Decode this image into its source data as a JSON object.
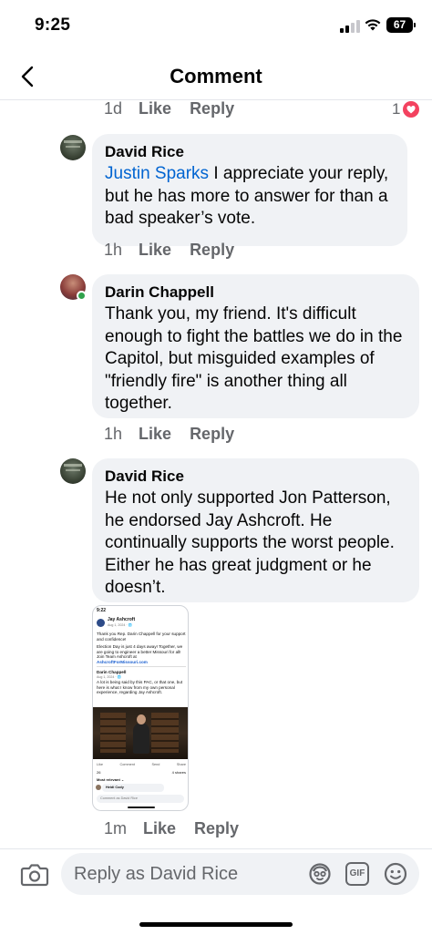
{
  "status_bar": {
    "time": "9:25",
    "battery": "67"
  },
  "header": {
    "title": "Comment"
  },
  "comments": [
    {
      "id": "prev",
      "meta": {
        "time": "1d",
        "like": "Like",
        "reply": "Reply"
      },
      "reactions": {
        "count": "1",
        "type": "heart-icon",
        "color": "#f3425f"
      }
    },
    {
      "id": "c1",
      "author": "David Rice",
      "mention": "Justin Sparks",
      "text": " I appreciate your reply, but he has more to answer for than a bad speaker’s vote.",
      "meta": {
        "time": "1h",
        "like": "Like",
        "reply": "Reply"
      }
    },
    {
      "id": "c2",
      "author": "Darin Chappell",
      "online": true,
      "text": "Thank you, my friend. It's difficult enough to fight the battles we do in the Capitol, but misguided examples of \"friendly fire\" is another thing all together.",
      "meta": {
        "time": "1h",
        "like": "Like",
        "reply": "Reply"
      }
    },
    {
      "id": "c3",
      "author": "David Rice",
      "text": "He not only supported Jon Patterson, he endorsed Jay Ashcroft. He continually supports the worst people. Either he has great judgment or he doesn’t.",
      "meta": {
        "time": "1m",
        "like": "Like",
        "reply": "Reply"
      },
      "attachment": {
        "status_time": "9:22",
        "page_name": "Jay Ashcroft",
        "post_date": "Aug 1, 2024 · 🌐",
        "line1": "Thank you Rep. Darin Chappell for your support and confidence!",
        "line2": "Election Day is just 4 days away! Together, we are going to engineer a better Missouri for all! Join Team Ashcroft at",
        "link": "AshcroftForMissouri.com",
        "inner_name": "Darin Chappell",
        "inner_date": "Aug 1, 2024 · 🌐",
        "inner_text": "A lot is being said by this PAC, or that one, but here is what I know from my own personal experience, regarding Jay Ashcroft.",
        "action_like": "Like",
        "action_comment": "Comment",
        "action_send": "Send",
        "action_share": "Share",
        "reactions": "26",
        "shares": "4 shares",
        "most_relevant": "Most relevant ⌄",
        "commenter": "Heidi Cody",
        "input_placeholder": "Comment as David Rice"
      }
    }
  ],
  "composer": {
    "placeholder": "Reply as David Rice",
    "gif_label": "GIF"
  },
  "colors": {
    "mention": "#0064d1",
    "bubble": "#f0f2f5",
    "meta_gray": "#65676b",
    "online": "#31a24c"
  }
}
